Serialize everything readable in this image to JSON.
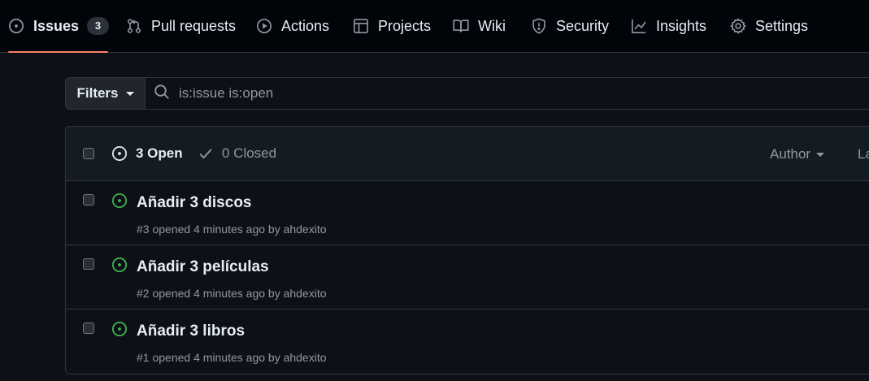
{
  "nav": {
    "tabs": [
      {
        "label": "Issues",
        "icon": "issue-opened-icon",
        "counter": "3",
        "active": true
      },
      {
        "label": "Pull requests",
        "icon": "git-pull-request-icon"
      },
      {
        "label": "Actions",
        "icon": "play-icon"
      },
      {
        "label": "Projects",
        "icon": "table-icon"
      },
      {
        "label": "Wiki",
        "icon": "book-icon"
      },
      {
        "label": "Security",
        "icon": "shield-icon"
      },
      {
        "label": "Insights",
        "icon": "graph-icon"
      },
      {
        "label": "Settings",
        "icon": "gear-icon"
      }
    ]
  },
  "filterbar": {
    "filters_label": "Filters",
    "search_value": "is:issue is:open"
  },
  "list_header": {
    "open_label": "3 Open",
    "closed_label": "0 Closed",
    "author_label": "Author",
    "label_label": "La"
  },
  "issues": [
    {
      "title": "Añadir 3 discos",
      "meta": "#3 opened 4 minutes ago by ahdexito"
    },
    {
      "title": "Añadir 3 películas",
      "meta": "#2 opened 4 minutes ago by ahdexito"
    },
    {
      "title": "Añadir 3 libros",
      "meta": "#1 opened 4 minutes ago by ahdexito"
    }
  ],
  "colors": {
    "open_green": "#3fb950",
    "active_underline": "#f78166",
    "background": "#0d1117",
    "nav_background": "#010409"
  }
}
